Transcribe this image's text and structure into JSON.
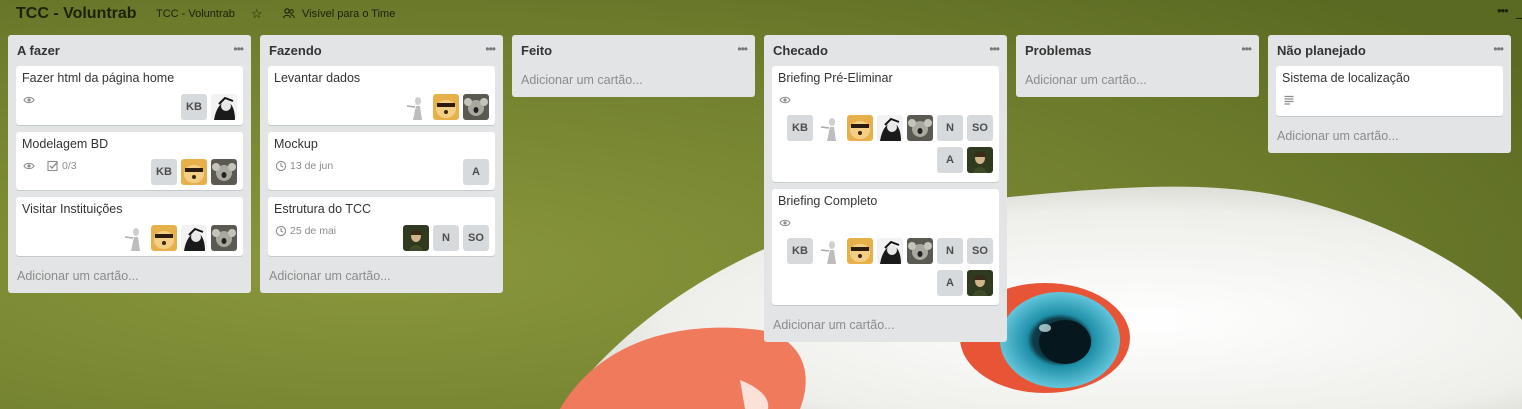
{
  "board": {
    "title": "TCC - Voluntrab",
    "org": "TCC - Voluntrab",
    "visibility": "Visível para o Time"
  },
  "icons": {
    "star": "star-icon",
    "visibility": "team-icon",
    "watch": "eye-icon",
    "checklist": "checklist-icon",
    "due": "clock-icon",
    "description": "description-icon",
    "list_menu": "ellipsis-icon"
  },
  "colors": {
    "background": "#6f7d2e",
    "list": "#e2e4e6",
    "card": "#ffffff",
    "initials_avatar": "#d6dadc"
  },
  "add_card_label": "Adicionar um cartão...",
  "lists": [
    {
      "name": "A fazer",
      "cards": [
        {
          "title": "Fazer html da página home",
          "badges": [
            {
              "icon": "eye-icon"
            }
          ],
          "members": [
            "KB",
            "photo:dark"
          ]
        },
        {
          "title": "Modelagem BD",
          "badges": [
            {
              "icon": "eye-icon"
            },
            {
              "icon": "checklist-icon",
              "text": "0/3"
            }
          ],
          "members": [
            "KB",
            "photo:dog",
            "photo:koala"
          ]
        },
        {
          "title": "Visitar Instituições",
          "badges": [],
          "members": [
            "photo:figure",
            "photo:dog",
            "photo:dark",
            "photo:koala"
          ]
        }
      ]
    },
    {
      "name": "Fazendo",
      "cards": [
        {
          "title": "Levantar dados",
          "badges": [],
          "members": [
            "photo:figure",
            "photo:dog",
            "photo:koala"
          ]
        },
        {
          "title": "Mockup",
          "badges": [
            {
              "icon": "clock-icon",
              "text": "13 de jun"
            }
          ],
          "members": [
            "A"
          ]
        },
        {
          "title": "Estrutura do TCC",
          "badges": [
            {
              "icon": "clock-icon",
              "text": "25 de mai"
            }
          ],
          "members": [
            "photo:woman",
            "N",
            "SO"
          ]
        }
      ]
    },
    {
      "name": "Feito",
      "cards": []
    },
    {
      "name": "Checado",
      "cards": [
        {
          "title": "Briefing Pré-Eliminar",
          "badges": [
            {
              "icon": "eye-icon"
            }
          ],
          "members": [
            "KB",
            "photo:figure",
            "photo:dog",
            "photo:dark",
            "photo:koala",
            "N",
            "SO",
            "A",
            "photo:woman"
          ]
        },
        {
          "title": "Briefing Completo",
          "badges": [
            {
              "icon": "eye-icon"
            }
          ],
          "members": [
            "KB",
            "photo:figure",
            "photo:dog",
            "photo:dark",
            "photo:koala",
            "N",
            "SO",
            "A",
            "photo:woman"
          ]
        }
      ]
    },
    {
      "name": "Problemas",
      "cards": []
    },
    {
      "name": "Não planejado",
      "cards": [
        {
          "title": "Sistema de localização",
          "badges": [
            {
              "icon": "description-icon"
            }
          ],
          "members": []
        }
      ]
    }
  ]
}
